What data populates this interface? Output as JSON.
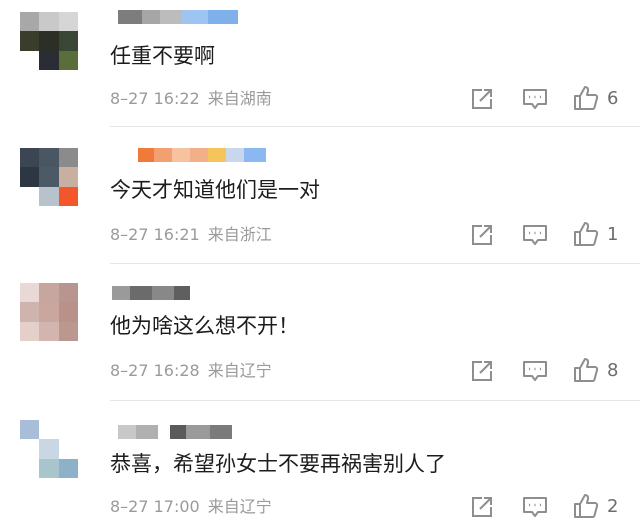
{
  "comments": [
    {
      "text": "任重不要啊",
      "time": "8–27 16:22",
      "location": "来自湖南",
      "likes": "6",
      "avatar_colors": [
        "#a8a8a8",
        "#c9c9c9",
        "#d6d6d6",
        "#3a3d2c",
        "#2b2f26",
        "#3b4736",
        "#ffffff",
        "#2a2d33",
        "#5a6e3a"
      ],
      "name_colors": [
        "#7d7d7d",
        "#a6a6a6",
        "#bcbcbc",
        "#9ec4f2",
        "#7fb0ea"
      ]
    },
    {
      "text": "今天才知道他们是一对",
      "time": "8–27 16:21",
      "location": "来自浙江",
      "likes": "1",
      "avatar_colors": [
        "#3b4652",
        "#4b5663",
        "#8b8b8b",
        "#2d3742",
        "#4c5a67",
        "#c7b09f",
        "#ffffff",
        "#b8c2cc",
        "#f2562a"
      ],
      "name_colors": [
        "#f07a3a",
        "#f3a070",
        "#f6c2a0",
        "#f2b08a",
        "#f5c45a",
        "#c8d6ee",
        "#8bb8f0"
      ]
    },
    {
      "text": "他为啥这么想不开！",
      "time": "8–27 16:28",
      "location": "来自辽宁",
      "likes": "8",
      "avatar_colors": [
        "#e8d8d6",
        "#c7a6a0",
        "#b8958e",
        "#cfb3ad",
        "#c9a79f",
        "#b8928a",
        "#e4cfcb",
        "#d2b5ae",
        "#ba978f"
      ],
      "name_colors": [
        "#9a9a9a",
        "#6b6b6b",
        "#888888",
        "#5f5f5f"
      ]
    },
    {
      "text": "恭喜，希望孙女士不要再祸害别人了",
      "time": "8–27 17:00",
      "location": "来自辽宁",
      "likes": "2",
      "avatar_colors": [
        "#a9bdd9",
        "#ffffff",
        "#ffffff",
        "#ffffff",
        "#c9d6e3",
        "#ffffff",
        "#ffffff",
        "#a9c5cc",
        "#8fb0c9"
      ],
      "name_colors": [
        "#c8c8c8",
        "#b0b0b0",
        "#ffffff",
        "#5a5a5a",
        "#9a9a9a",
        "#7a7a7a"
      ]
    }
  ]
}
